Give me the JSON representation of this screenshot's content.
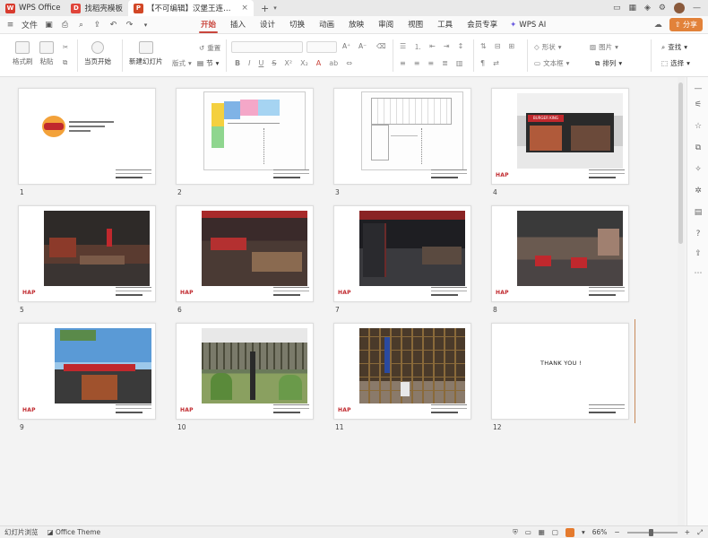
{
  "tabs": [
    {
      "label": "WPS Office",
      "badge": "W",
      "badge_color": "#d83b2e"
    },
    {
      "label": "找稻壳模板",
      "badge": "D",
      "badge_color": "#e0453a"
    },
    {
      "label": "【不可编辑】汉堡王连锁快餐...",
      "badge": "P",
      "badge_color": "#d24726"
    }
  ],
  "menubar": {
    "file_label": "文件",
    "menus": [
      "开始",
      "插入",
      "设计",
      "切换",
      "动画",
      "放映",
      "审阅",
      "视图",
      "工具",
      "会员专享"
    ],
    "active_menu": "开始",
    "wps_ai": "WPS AI",
    "share": "分享"
  },
  "ribbon": {
    "format_painter": "格式刷",
    "paste": "粘贴",
    "play_from_current": "当页开始",
    "new_slide": "新建幻灯片",
    "layout": "版式",
    "section": "节",
    "reset": "重置",
    "shape": "形状",
    "picture": "图片",
    "textbox": "文本框",
    "arrange": "排列",
    "find": "查找",
    "select": "选择"
  },
  "slides": [
    {
      "num": "1",
      "kind": "cover"
    },
    {
      "num": "2",
      "kind": "plan-color"
    },
    {
      "num": "3",
      "kind": "plan"
    },
    {
      "num": "4",
      "kind": "storefront",
      "store_text": "BURGER KING"
    },
    {
      "num": "5",
      "kind": "interior-warm"
    },
    {
      "num": "6",
      "kind": "interior-red"
    },
    {
      "num": "7",
      "kind": "interior-dark"
    },
    {
      "num": "8",
      "kind": "interior-seats"
    },
    {
      "num": "9",
      "kind": "exterior-sky"
    },
    {
      "num": "10",
      "kind": "construction-green"
    },
    {
      "num": "11",
      "kind": "construction-scaffold"
    },
    {
      "num": "12",
      "kind": "thanks",
      "text": "THANK YOU !"
    }
  ],
  "hap_text": "HAP",
  "status": {
    "view_label": "幻灯片浏览",
    "theme_label": "Office Theme",
    "zoom": "66%"
  }
}
